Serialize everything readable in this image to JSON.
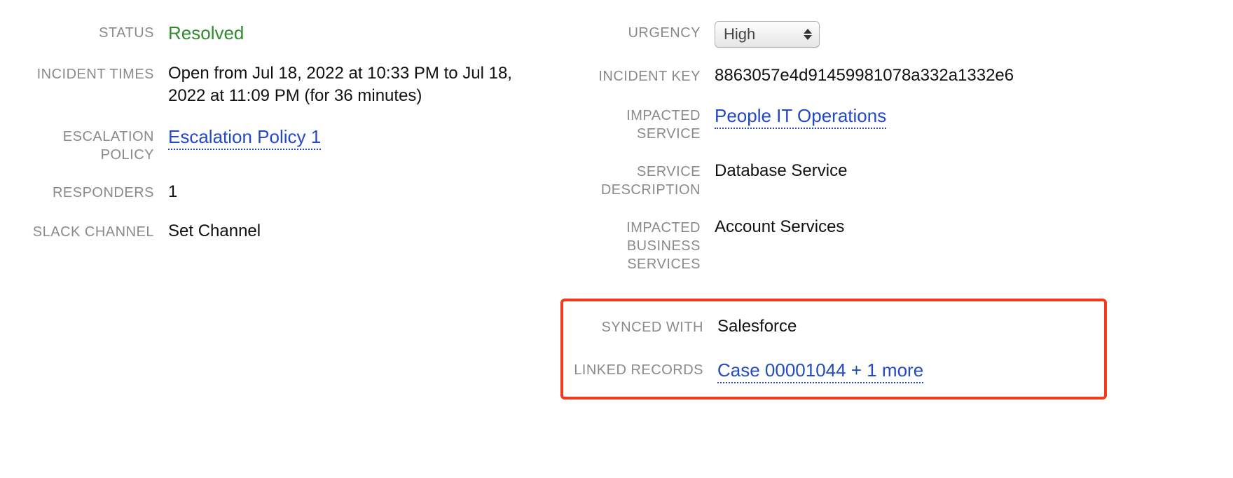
{
  "left": {
    "status": {
      "label": "STATUS",
      "value": "Resolved"
    },
    "incident_times": {
      "label": "INCIDENT TIMES",
      "value": "Open from Jul 18, 2022 at 10:33 PM to Jul 18, 2022 at 11:09 PM (for 36 minutes)"
    },
    "escalation_policy": {
      "label": "ESCALATION POLICY",
      "value": "Escalation Policy 1"
    },
    "responders": {
      "label": "RESPONDERS",
      "value": "1"
    },
    "slack_channel": {
      "label": "SLACK CHANNEL",
      "value": "Set Channel"
    }
  },
  "right": {
    "urgency": {
      "label": "URGENCY",
      "value": "High"
    },
    "incident_key": {
      "label": "INCIDENT KEY",
      "value": "8863057e4d91459981078a332a1332e6"
    },
    "impacted_service": {
      "label": "IMPACTED SERVICE",
      "value": "People IT Operations"
    },
    "service_description": {
      "label": "SERVICE DESCRIPTION",
      "value": "Database Service"
    },
    "impacted_business_services": {
      "label": "IMPACTED BUSINESS SERVICES",
      "value": "Account Services"
    },
    "synced_with": {
      "label": "SYNCED WITH",
      "value": "Salesforce"
    },
    "linked_records": {
      "label": "LINKED RECORDS",
      "value": "Case 00001044 + 1 more"
    }
  }
}
